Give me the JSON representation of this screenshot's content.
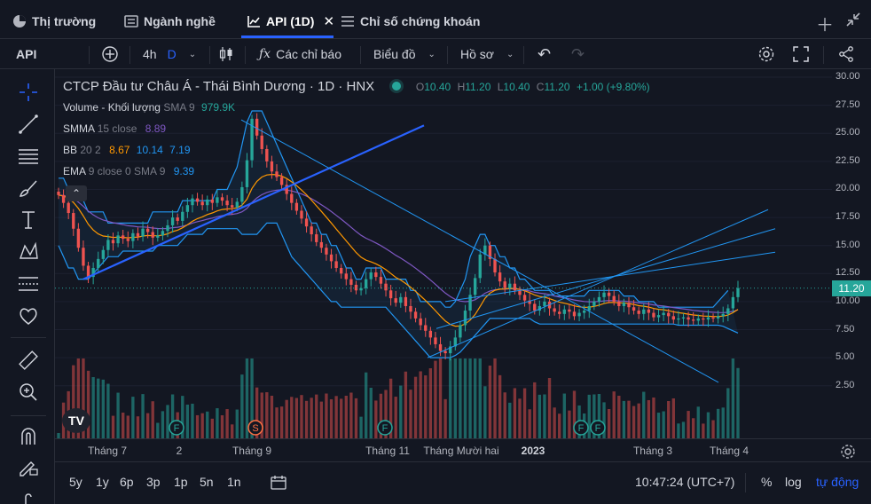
{
  "tabs": [
    {
      "label": "Thị trường",
      "icon": "pie-chart-icon"
    },
    {
      "label": "Ngành nghề",
      "icon": "list-icon"
    },
    {
      "label": "API (1D)",
      "icon": "chart-icon",
      "active": true
    },
    {
      "label": "Chỉ số chứng khoán",
      "icon": "list-icon"
    }
  ],
  "toolbar": {
    "symbol": "API",
    "interval": "4h",
    "interval_d": "D",
    "indicators_label": "Các chỉ báo",
    "chart_type_label": "Biểu đồ",
    "profile_label": "Hồ sơ"
  },
  "legend": {
    "title": "CTCP Đầu tư Châu Á - Thái Bình Dương · 1D · HNX",
    "o_label": "O",
    "o": "10.40",
    "h_label": "H",
    "h": "11.20",
    "l_label": "L",
    "l": "10.40",
    "c_label": "C",
    "c": "11.20",
    "change": "+1.00 (+9.80%)",
    "volume_name": "Volume - Khối lượng",
    "volume_params": "SMA 9",
    "volume_value": "979.9K",
    "smma_name": "SMMA",
    "smma_params": "15 close",
    "smma_value": "8.89",
    "bb_name": "BB",
    "bb_params": "20 2",
    "bb_v1": "8.67",
    "bb_v2": "10.14",
    "bb_v3": "7.19",
    "ema_name": "EMA",
    "ema_params": "9 close 0 SMA 9",
    "ema_value": "9.39"
  },
  "colors": {
    "up": "#26a69a",
    "down": "#ef5350",
    "smma": "#7e57c2",
    "bb": "#2196f3",
    "ema": "#ff9800",
    "trendline": "#2962ff",
    "accent": "#2962ff"
  },
  "price_axis": {
    "ticks": [
      "30.00",
      "27.50",
      "25.00",
      "22.50",
      "20.00",
      "17.50",
      "15.00",
      "12.50",
      "10.00",
      "7.50",
      "5.00",
      "2.50"
    ],
    "last_price": "11.20"
  },
  "time_axis": [
    "Tháng 7",
    "2",
    "Tháng 9",
    "Tháng 11",
    "Tháng Mười hai",
    "2023",
    "Tháng 3",
    "Tháng 4"
  ],
  "bottom": {
    "ranges": [
      "5y",
      "1y",
      "6p",
      "3p",
      "1p",
      "5n",
      "1n"
    ],
    "clock": "10:47:24 (UTC+7)",
    "percent": "%",
    "log": "log",
    "auto": "tự động"
  },
  "chart_data": {
    "type": "candlestick",
    "symbol": "API",
    "interval": "1D",
    "ylim": [
      0,
      31
    ],
    "price_ticks": [
      2.5,
      5,
      7.5,
      10,
      12.5,
      15,
      17.5,
      20,
      22.5,
      25,
      27.5,
      30
    ],
    "close": [
      19.5,
      18.8,
      17.9,
      16.5,
      14.8,
      13.2,
      12.2,
      13.0,
      13.8,
      14.6,
      15.5,
      15.2,
      15.9,
      15.6,
      15.4,
      16.1,
      15.8,
      16.5,
      16.2,
      15.7,
      15.9,
      16.3,
      16.8,
      17.5,
      17.2,
      18.0,
      18.6,
      19.2,
      18.9,
      18.6,
      19.1,
      18.8,
      19.3,
      19.0,
      18.6,
      18.4,
      18.9,
      20.2,
      22.6,
      26.3,
      24.8,
      23.6,
      22.5,
      21.6,
      21.1,
      20.4,
      19.6,
      18.8,
      18.1,
      17.4,
      16.7,
      16.0,
      15.3,
      14.8,
      14.2,
      13.6,
      13.0,
      12.5,
      12.0,
      11.5,
      11.0,
      11.2,
      12.0,
      12.6,
      12.2,
      11.6,
      11.0,
      10.3,
      9.9,
      10.4,
      9.6,
      9.1,
      8.5,
      7.9,
      7.4,
      6.8,
      6.2,
      5.6,
      5.4,
      6.0,
      6.8,
      7.9,
      9.2,
      10.6,
      12.1,
      14.2,
      15.0,
      13.8,
      12.6,
      11.8,
      11.2,
      11.6,
      11.0,
      10.6,
      10.1,
      9.8,
      9.2,
      9.6,
      10.0,
      9.4,
      9.1,
      8.9,
      9.3,
      9.1,
      8.7,
      9.0,
      9.2,
      9.6,
      10.0,
      10.4,
      10.8,
      10.5,
      10.0,
      9.6,
      9.9,
      9.5,
      9.2,
      8.9,
      9.3,
      9.0,
      8.6,
      8.8,
      9.0,
      8.7,
      8.4,
      8.5,
      8.6,
      8.4,
      8.3,
      8.5,
      8.4,
      8.6,
      8.5,
      8.7,
      8.9,
      9.4,
      10.4,
      11.2
    ],
    "bb_upper": [
      21,
      21,
      20,
      20,
      19,
      19,
      18,
      18,
      18,
      18,
      17,
      17,
      17,
      17,
      17,
      17,
      17,
      17,
      17,
      18,
      18,
      18,
      18,
      18,
      18,
      19,
      19,
      19,
      19,
      19,
      19,
      19,
      20,
      20,
      20,
      21,
      22,
      24,
      26,
      27,
      27,
      27,
      26,
      25,
      24,
      23,
      22,
      21,
      20,
      19,
      18,
      17,
      17,
      16,
      16,
      15,
      15,
      14,
      13,
      13,
      12,
      12,
      13,
      13,
      13,
      13,
      12,
      12,
      12,
      12,
      12,
      11,
      11,
      10,
      10,
      10,
      10,
      10,
      9.5,
      9.5,
      10,
      11,
      12,
      14,
      15,
      16,
      16,
      15,
      15,
      14,
      14,
      13,
      13,
      12,
      12,
      11.5,
      11,
      11,
      11,
      11,
      10.5,
      10.5,
      10.5,
      10.5,
      10.5,
      10.5,
      10.5,
      11,
      11,
      11,
      11,
      11,
      11,
      11,
      10.5,
      10.5,
      10.5,
      10,
      10,
      10,
      10,
      9.5,
      9.5,
      9.5,
      9.5,
      9.5,
      9.5,
      9.5,
      9.5,
      9.5,
      9.5,
      9.5,
      9.5,
      10,
      10.5,
      11
    ],
    "bb_lower": [
      15,
      14,
      13,
      13,
      12,
      12,
      12,
      12.5,
      13,
      13.5,
      14,
      14,
      14,
      14.5,
      14.5,
      14.5,
      14.5,
      14.5,
      14.5,
      14.5,
      15,
      15,
      15,
      15,
      15,
      15.5,
      16,
      16,
      16,
      16,
      16.5,
      16.5,
      16.5,
      16.5,
      16.5,
      16.5,
      16.5,
      16,
      16,
      16,
      16,
      16.5,
      17,
      17,
      17,
      16,
      15,
      14,
      13.5,
      13,
      12.5,
      12,
      11.5,
      11,
      10.5,
      10,
      10,
      9.5,
      9.5,
      9.5,
      9.5,
      9.5,
      9.5,
      9.5,
      9.5,
      9.5,
      9.5,
      9,
      8.5,
      8,
      7.5,
      7,
      6.5,
      6,
      5.5,
      5,
      5,
      5,
      5,
      5,
      5.2,
      5.5,
      6,
      6.5,
      7,
      7.5,
      8,
      8.5,
      8.5,
      8.5,
      8.5,
      8.5,
      8.5,
      8.5,
      8.5,
      8.5,
      8.2,
      8,
      8,
      8,
      8,
      8,
      8,
      8,
      8,
      8,
      8,
      8,
      8,
      8,
      8,
      8,
      8,
      8,
      8,
      8,
      8,
      8,
      8,
      8,
      8,
      8,
      8,
      8,
      8,
      7.9,
      7.9,
      7.9,
      7.9,
      7.9,
      7.9,
      7.9,
      7.9,
      7.9,
      7.8,
      7.6,
      7.4,
      7.2
    ]
  }
}
